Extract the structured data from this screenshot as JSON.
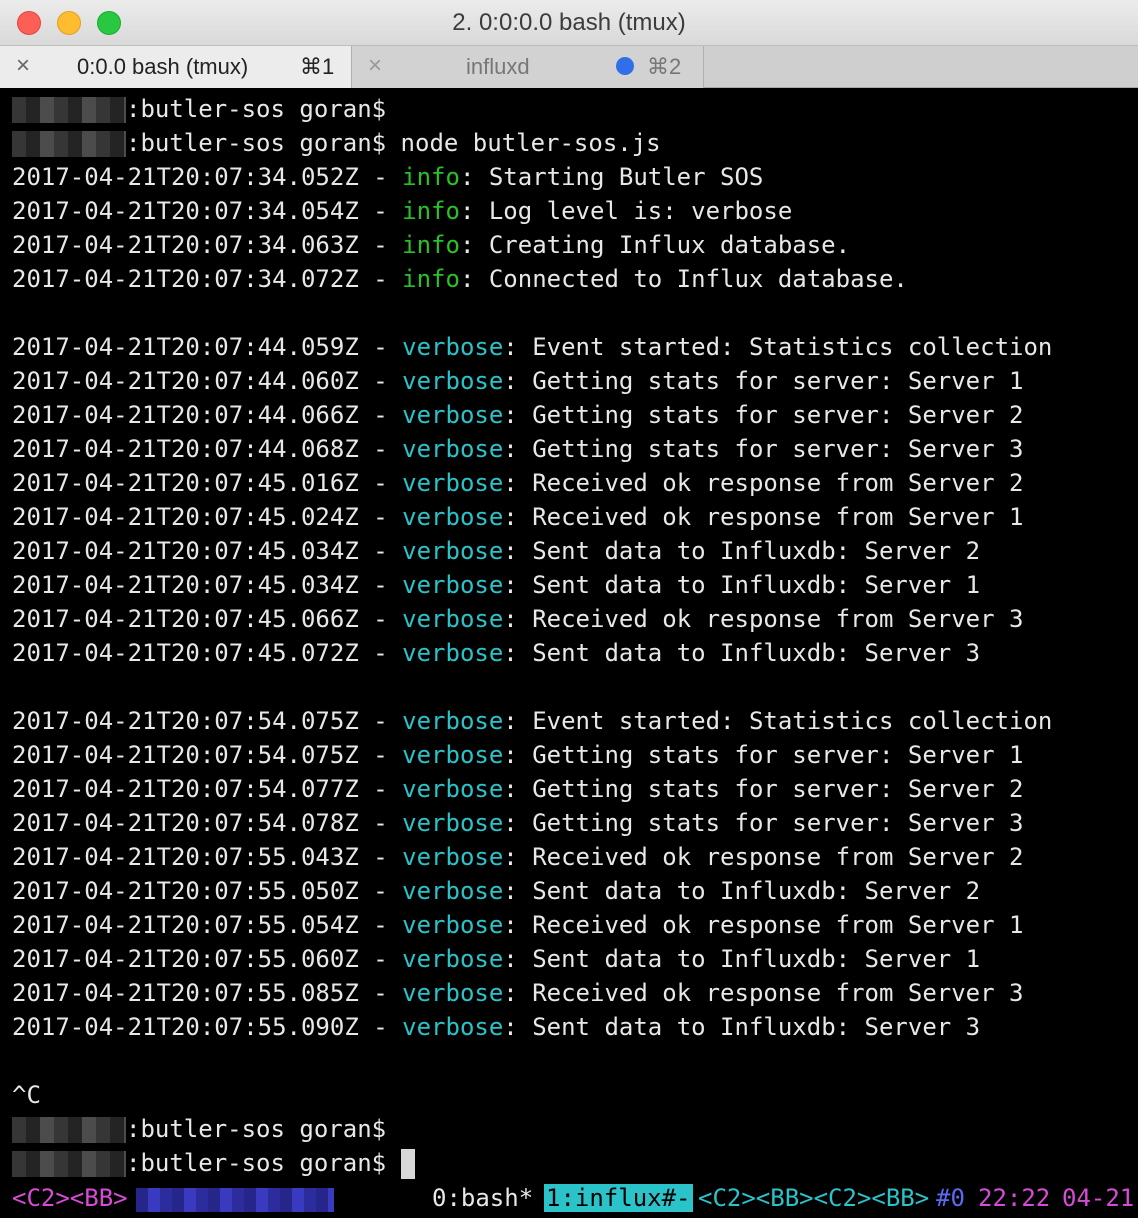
{
  "window": {
    "title": "2. 0:0:0.0 bash (tmux)"
  },
  "tabs": [
    {
      "label": "0:0.0 bash (tmux)",
      "shortcut": "⌘1",
      "close": "×"
    },
    {
      "label": "influxd",
      "shortcut": "⌘2",
      "close": "×"
    }
  ],
  "prompt": {
    "suffix": ":butler-sos goran$",
    "command": " node butler-sos.js"
  },
  "log": {
    "info": [
      {
        "ts": "2017-04-21T20:07:34.052Z",
        "msg": "Starting Butler SOS"
      },
      {
        "ts": "2017-04-21T20:07:34.054Z",
        "msg": "Log level is: verbose"
      },
      {
        "ts": "2017-04-21T20:07:34.063Z",
        "msg": "Creating Influx database."
      },
      {
        "ts": "2017-04-21T20:07:34.072Z",
        "msg": "Connected to Influx database."
      }
    ],
    "block1": [
      {
        "ts": "2017-04-21T20:07:44.059Z",
        "msg": "Event started: Statistics collection"
      },
      {
        "ts": "2017-04-21T20:07:44.060Z",
        "msg": "Getting stats for server: Server 1"
      },
      {
        "ts": "2017-04-21T20:07:44.066Z",
        "msg": "Getting stats for server: Server 2"
      },
      {
        "ts": "2017-04-21T20:07:44.068Z",
        "msg": "Getting stats for server: Server 3"
      },
      {
        "ts": "2017-04-21T20:07:45.016Z",
        "msg": "Received ok response from Server 2"
      },
      {
        "ts": "2017-04-21T20:07:45.024Z",
        "msg": "Received ok response from Server 1"
      },
      {
        "ts": "2017-04-21T20:07:45.034Z",
        "msg": "Sent data to Influxdb: Server 2"
      },
      {
        "ts": "2017-04-21T20:07:45.034Z",
        "msg": "Sent data to Influxdb: Server 1"
      },
      {
        "ts": "2017-04-21T20:07:45.066Z",
        "msg": "Received ok response from Server 3"
      },
      {
        "ts": "2017-04-21T20:07:45.072Z",
        "msg": "Sent data to Influxdb: Server 3"
      }
    ],
    "block2": [
      {
        "ts": "2017-04-21T20:07:54.075Z",
        "msg": "Event started: Statistics collection"
      },
      {
        "ts": "2017-04-21T20:07:54.075Z",
        "msg": "Getting stats for server: Server 1"
      },
      {
        "ts": "2017-04-21T20:07:54.077Z",
        "msg": "Getting stats for server: Server 2"
      },
      {
        "ts": "2017-04-21T20:07:54.078Z",
        "msg": "Getting stats for server: Server 3"
      },
      {
        "ts": "2017-04-21T20:07:55.043Z",
        "msg": "Received ok response from Server 2"
      },
      {
        "ts": "2017-04-21T20:07:55.050Z",
        "msg": "Sent data to Influxdb: Server 2"
      },
      {
        "ts": "2017-04-21T20:07:55.054Z",
        "msg": "Received ok response from Server 1"
      },
      {
        "ts": "2017-04-21T20:07:55.060Z",
        "msg": "Sent data to Influxdb: Server 1"
      },
      {
        "ts": "2017-04-21T20:07:55.085Z",
        "msg": "Received ok response from Server 3"
      },
      {
        "ts": "2017-04-21T20:07:55.090Z",
        "msg": "Sent data to Influxdb: Server 3"
      }
    ]
  },
  "levels": {
    "info": "info",
    "verbose": "verbose",
    "sep": " - "
  },
  "interrupt": "^C",
  "statusbar": {
    "left": "<C2><BB>",
    "win0": "0:bash*",
    "win1": "1:influx#-",
    "right_marks": "<C2><BB><C2><BB>",
    "session": "#0",
    "time": "22:22",
    "date": "04-21"
  },
  "colors": {
    "info": "#26c226",
    "verbose": "#2ac3c9",
    "status_magenta": "#d84bd6",
    "status_cyan": "#2ac3c9",
    "status_blue": "#5b6af5"
  }
}
